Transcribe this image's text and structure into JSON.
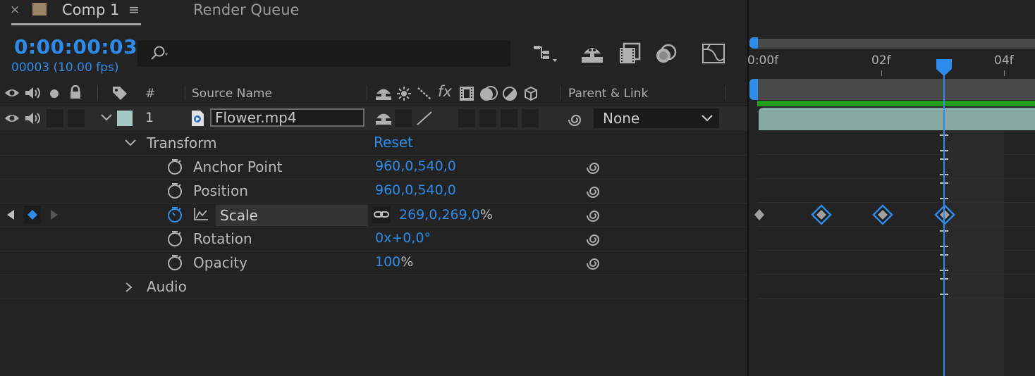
{
  "tabs": [
    {
      "close": "×",
      "title": "Comp 1",
      "menu": "≡"
    },
    {
      "title": "Render Queue"
    }
  ],
  "time": {
    "timecode": "0:00:00:03",
    "frames": "00003 (10.00 fps)"
  },
  "search": {
    "placeholder": ""
  },
  "columns": {
    "number": "#",
    "source_name": "Source Name",
    "fx": "fx",
    "parent": "Parent & Link"
  },
  "layer": {
    "number": "1",
    "name": "Flower.mp4",
    "parent": "None"
  },
  "transform": {
    "label": "Transform",
    "reset": "Reset"
  },
  "properties": [
    {
      "label": "Anchor Point",
      "value": "960,0,540,0",
      "unit": ""
    },
    {
      "label": "Position",
      "value": "960,0,540,0",
      "unit": ""
    },
    {
      "label": "Scale",
      "value": "269,0,269,0",
      "unit": "%"
    },
    {
      "label": "Rotation",
      "value": "0x+0,0°",
      "unit": ""
    },
    {
      "label": "Opacity",
      "value": "100",
      "unit": "%"
    }
  ],
  "audio": {
    "label": "Audio"
  },
  "timeline": {
    "ruler": [
      "0:00f",
      "02f",
      "04f"
    ],
    "current_frame": 3,
    "scale_keyframe_frames": [
      0,
      1,
      2,
      3
    ]
  },
  "colors": {
    "accent": "#2d8ceb",
    "clip": "#86aaa2",
    "label_swatch": "#a3c8c2",
    "comp_swatch": "#9c8467",
    "green_bar": "#1ea01e"
  }
}
